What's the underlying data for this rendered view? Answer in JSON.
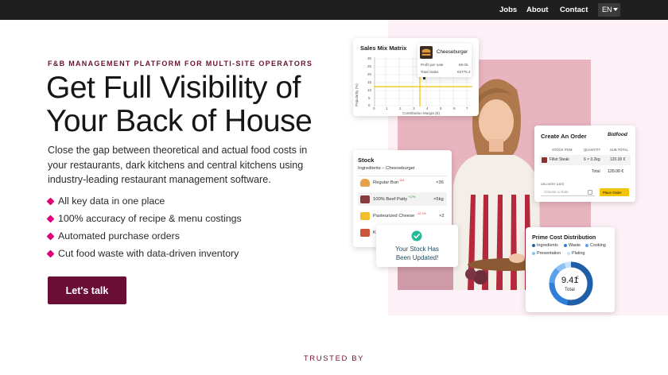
{
  "nav": {
    "links": [
      "Jobs",
      "About",
      "Contact"
    ],
    "language": "EN"
  },
  "hero": {
    "eyebrow": "F&B MANAGEMENT PLATFORM FOR MULTI-SITE OPERATORS",
    "title_line1": "Get Full Visibility of",
    "title_line2": "Your Back of House",
    "description": "Close the gap between theoretical and actual food costs in your restaurants, dark kitchens and central kitchens using industry-leading restaurant management software.",
    "bullets": [
      "All key data in one place",
      "100% accuracy of recipe & menu costings",
      "Automated purchase orders",
      "Cut food waste with data-driven inventory"
    ],
    "cta_label": "Let's talk"
  },
  "trusted_label": "TRUSTED BY",
  "sales_mix": {
    "title": "Sales Mix Matrix",
    "y_axis_label": "Popularity (%)",
    "x_axis_label": "Contribution Margin (€)",
    "y_ticks": [
      "30",
      "25",
      "20",
      "15",
      "10",
      "5",
      "0"
    ],
    "x_ticks": [
      "0",
      "1",
      "2",
      "3",
      "4",
      "5",
      "6",
      "7"
    ],
    "item_name": "Cheeseburger",
    "profit_label": "Profit per sale",
    "profit_value": "€8.05",
    "total_label": "Total Sales",
    "total_value": "€3775.4"
  },
  "order": {
    "title": "Create An Order",
    "brand": "Bidfood",
    "col_item": "STOCK ITEM",
    "col_qty": "QUANTITY",
    "col_sub": "SUB TOTAL",
    "item": "Fillet Steak",
    "qty": "6 × 0.2kg",
    "subtotal": "120.00 €",
    "total_label": "Total",
    "total_value": "120.00 €",
    "delivery_label": "DELIVERY DATE",
    "date_placeholder": "Choose a Date",
    "place_label": "Place Order"
  },
  "stock": {
    "title": "Stock",
    "subtitle": "Ingredients – Cheeseburger",
    "rows": [
      {
        "name": "Regular Bun",
        "tag": "-5.6",
        "qty": "×36"
      },
      {
        "name": "100% Beef Patty",
        "tag": "+17%",
        "qty": "×5kg"
      },
      {
        "name": "Pasteurized Cheese",
        "tag": "-12.1%",
        "qty": "×2"
      },
      {
        "name": "K",
        "tag": "",
        "qty": ""
      }
    ]
  },
  "toast": {
    "line1": "Your Stock Has",
    "line2": "Been Updated!"
  },
  "prime_cost": {
    "title": "Prime Cost Distribution",
    "legend": [
      {
        "label": "Ingredients",
        "color": "#1f5fa8"
      },
      {
        "label": "Waste",
        "color": "#2f7fd8"
      },
      {
        "label": "Cooking",
        "color": "#5aa0ea"
      },
      {
        "label": "Presentation",
        "color": "#8cc0f4"
      },
      {
        "label": "Plating",
        "color": "#c4e0fb"
      }
    ],
    "value": "9.41",
    "value_unit": "£",
    "value_label": "Total"
  }
}
